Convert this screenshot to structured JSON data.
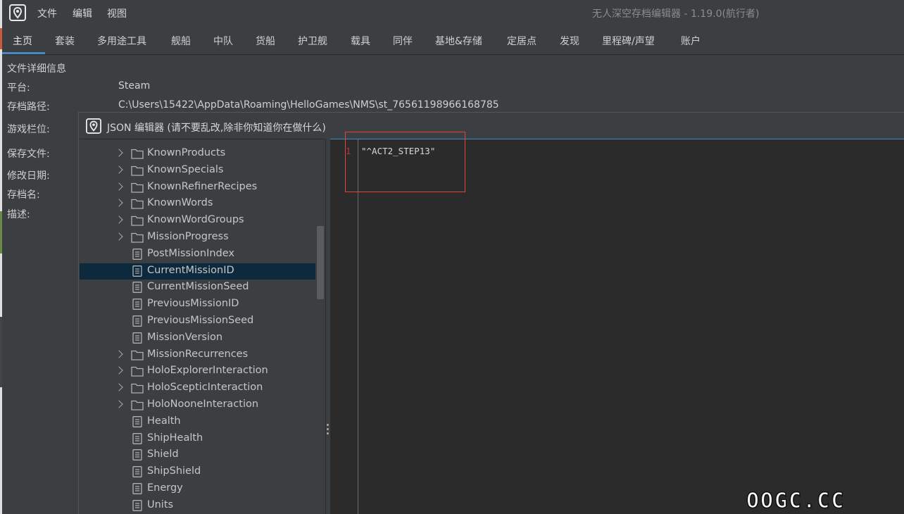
{
  "window": {
    "title": "无人深空存档编辑器 - 1.19.0(航行者)"
  },
  "menu": [
    "文件",
    "编辑",
    "视图"
  ],
  "tabs": [
    "主页",
    "套装",
    "多用途工具",
    "舰船",
    "中队",
    "货船",
    "护卫舰",
    "载具",
    "同伴",
    "基地&存储",
    "定居点",
    "发现",
    "里程碑/声望",
    "账户"
  ],
  "active_tab": "主页",
  "details": {
    "section_title": "文件详细信息",
    "platform_label": "平台:",
    "platform_value": "Steam",
    "path_label": "存档路径:",
    "path_value": "C:\\Users\\15422\\AppData\\Roaming\\HelloGames\\NMS\\st_76561198966168785",
    "slot_label": "游戏栏位:",
    "save_file_label": "保存文件:",
    "modified_label": "修改日期:",
    "save_name_label": "存档名:",
    "description_label": "描述:"
  },
  "dialog": {
    "title": "JSON 编辑器 (请不要乱改,除非你知道你在做什么)",
    "tree": [
      {
        "label": "KnownProducts",
        "type": "folder"
      },
      {
        "label": "KnownSpecials",
        "type": "folder"
      },
      {
        "label": "KnownRefinerRecipes",
        "type": "folder"
      },
      {
        "label": "KnownWords",
        "type": "folder"
      },
      {
        "label": "KnownWordGroups",
        "type": "folder"
      },
      {
        "label": "MissionProgress",
        "type": "folder"
      },
      {
        "label": "PostMissionIndex",
        "type": "value"
      },
      {
        "label": "CurrentMissionID",
        "type": "value",
        "selected": true
      },
      {
        "label": "CurrentMissionSeed",
        "type": "value"
      },
      {
        "label": "PreviousMissionID",
        "type": "value"
      },
      {
        "label": "PreviousMissionSeed",
        "type": "value"
      },
      {
        "label": "MissionVersion",
        "type": "value"
      },
      {
        "label": "MissionRecurrences",
        "type": "folder"
      },
      {
        "label": "HoloExplorerInteraction",
        "type": "folder"
      },
      {
        "label": "HoloScepticInteraction",
        "type": "folder"
      },
      {
        "label": "HoloNooneInteraction",
        "type": "folder"
      },
      {
        "label": "Health",
        "type": "value"
      },
      {
        "label": "ShipHealth",
        "type": "value"
      },
      {
        "label": "Shield",
        "type": "value"
      },
      {
        "label": "ShipShield",
        "type": "value"
      },
      {
        "label": "Energy",
        "type": "value"
      },
      {
        "label": "Units",
        "type": "value"
      }
    ],
    "editor": {
      "line_number": "1",
      "content": "\"^ACT2_STEP13\""
    }
  },
  "watermark": "OOGC.CC",
  "colors": {
    "background": "#3c3f41",
    "editor_bg": "#2b2b2b",
    "selection": "#0d293e",
    "accent": "#4a88c7",
    "highlight_box": "#e0453f"
  }
}
